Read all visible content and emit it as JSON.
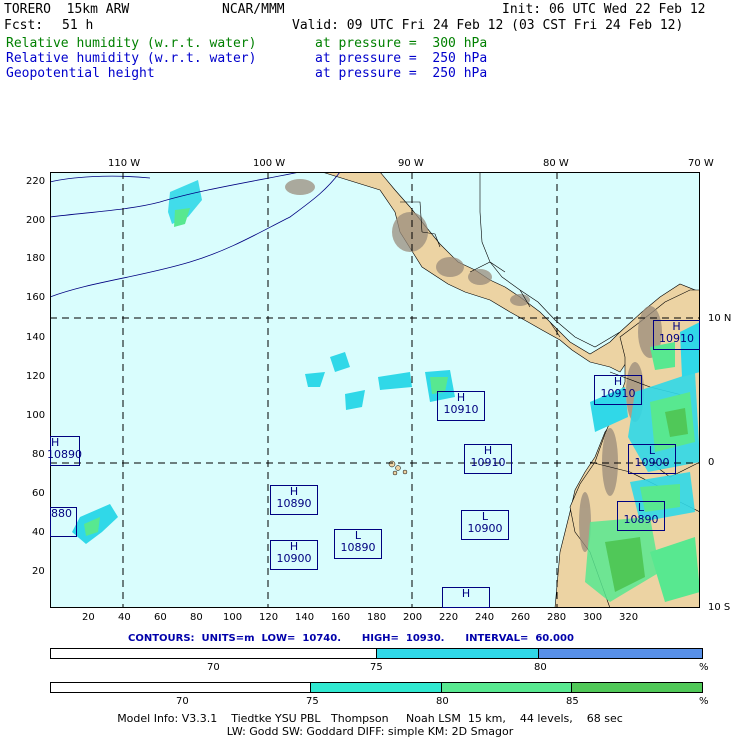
{
  "header": {
    "model": "TORERO  15km ARW",
    "org": "NCAR/MMM",
    "init": "Init: 06 UTC Wed 22 Feb 12",
    "fcst_label": "Fcst:",
    "fcst_value": "51 h",
    "valid": "Valid: 09 UTC Fri 24 Feb 12 (03 CST Fri 24 Feb 12)",
    "fields": [
      {
        "name": "Relative humidity (w.r.t. water)",
        "level": "at pressure =  300 hPa",
        "color": "#008000"
      },
      {
        "name": "Relative humidity (w.r.t. water)",
        "level": "at pressure =  250 hPa",
        "color": "#0000cc"
      },
      {
        "name": "Geopotential height",
        "level": "at pressure =  250 hPa",
        "color": "#0000cc"
      }
    ]
  },
  "map": {
    "top_lon_labels": [
      "110 W",
      "100 W",
      "90 W",
      "80 W",
      "70 W"
    ],
    "right_lat_labels": [
      "10 N",
      "0",
      "10 S"
    ],
    "y_ticks": [
      "220",
      "200",
      "180",
      "160",
      "140",
      "120",
      "100",
      "80",
      "60",
      "40",
      "20"
    ],
    "x_ticks": [
      "20",
      "40",
      "60",
      "80",
      "100",
      "120",
      "140",
      "160",
      "180",
      "200",
      "220",
      "240",
      "260",
      "280",
      "300",
      "320"
    ],
    "pressure_centers": [
      {
        "type": "H",
        "value": "10910"
      },
      {
        "type": "H",
        "value": "10910"
      },
      {
        "type": "H",
        "value": "10910"
      },
      {
        "type": "H",
        "value": "10910"
      },
      {
        "type": "L",
        "value": "10900"
      },
      {
        "type": "L",
        "value": "10890"
      },
      {
        "type": "L",
        "value": "10900"
      },
      {
        "type": "H",
        "value": "10890"
      },
      {
        "type": "L",
        "value": "10890"
      },
      {
        "type": "H",
        "value": "10900"
      },
      {
        "type": "H",
        "value": "10890"
      },
      {
        "type": "",
        "value": "880"
      },
      {
        "type": "H",
        "value": "10900"
      }
    ],
    "colors": {
      "ocean": "#d9fdfd",
      "land": "#ecd3a3",
      "terrain": "#9a8c7c",
      "grid": "#000000"
    }
  },
  "contours": {
    "text": "CONTOURS:  UNITS=m  LOW=  10740.      HIGH=  10930.      INTERVAL=  60.000"
  },
  "colorbars": [
    {
      "segments": [
        {
          "color": "#ffffff",
          "frac": 0.5
        },
        {
          "color": "#30d8e8",
          "frac": 0.25
        },
        {
          "color": "#5890e8",
          "frac": 0.25
        }
      ],
      "labels": [
        "70",
        "75",
        "80",
        "%"
      ]
    },
    {
      "segments": [
        {
          "color": "#ffffff",
          "frac": 0.4
        },
        {
          "color": "#30e8d0",
          "frac": 0.2
        },
        {
          "color": "#58e890",
          "frac": 0.2
        },
        {
          "color": "#50c858",
          "frac": 0.2
        }
      ],
      "labels": [
        "70",
        "75",
        "80",
        "85",
        "%"
      ]
    }
  ],
  "footer": {
    "line1": "Model Info: V3.3.1    Tiedtke YSU PBL   Thompson     Noah LSM  15 km,    44 levels,    68 sec",
    "line2": "LW: Godd SW: Goddard DIFF: simple KM: 2D Smagor"
  }
}
